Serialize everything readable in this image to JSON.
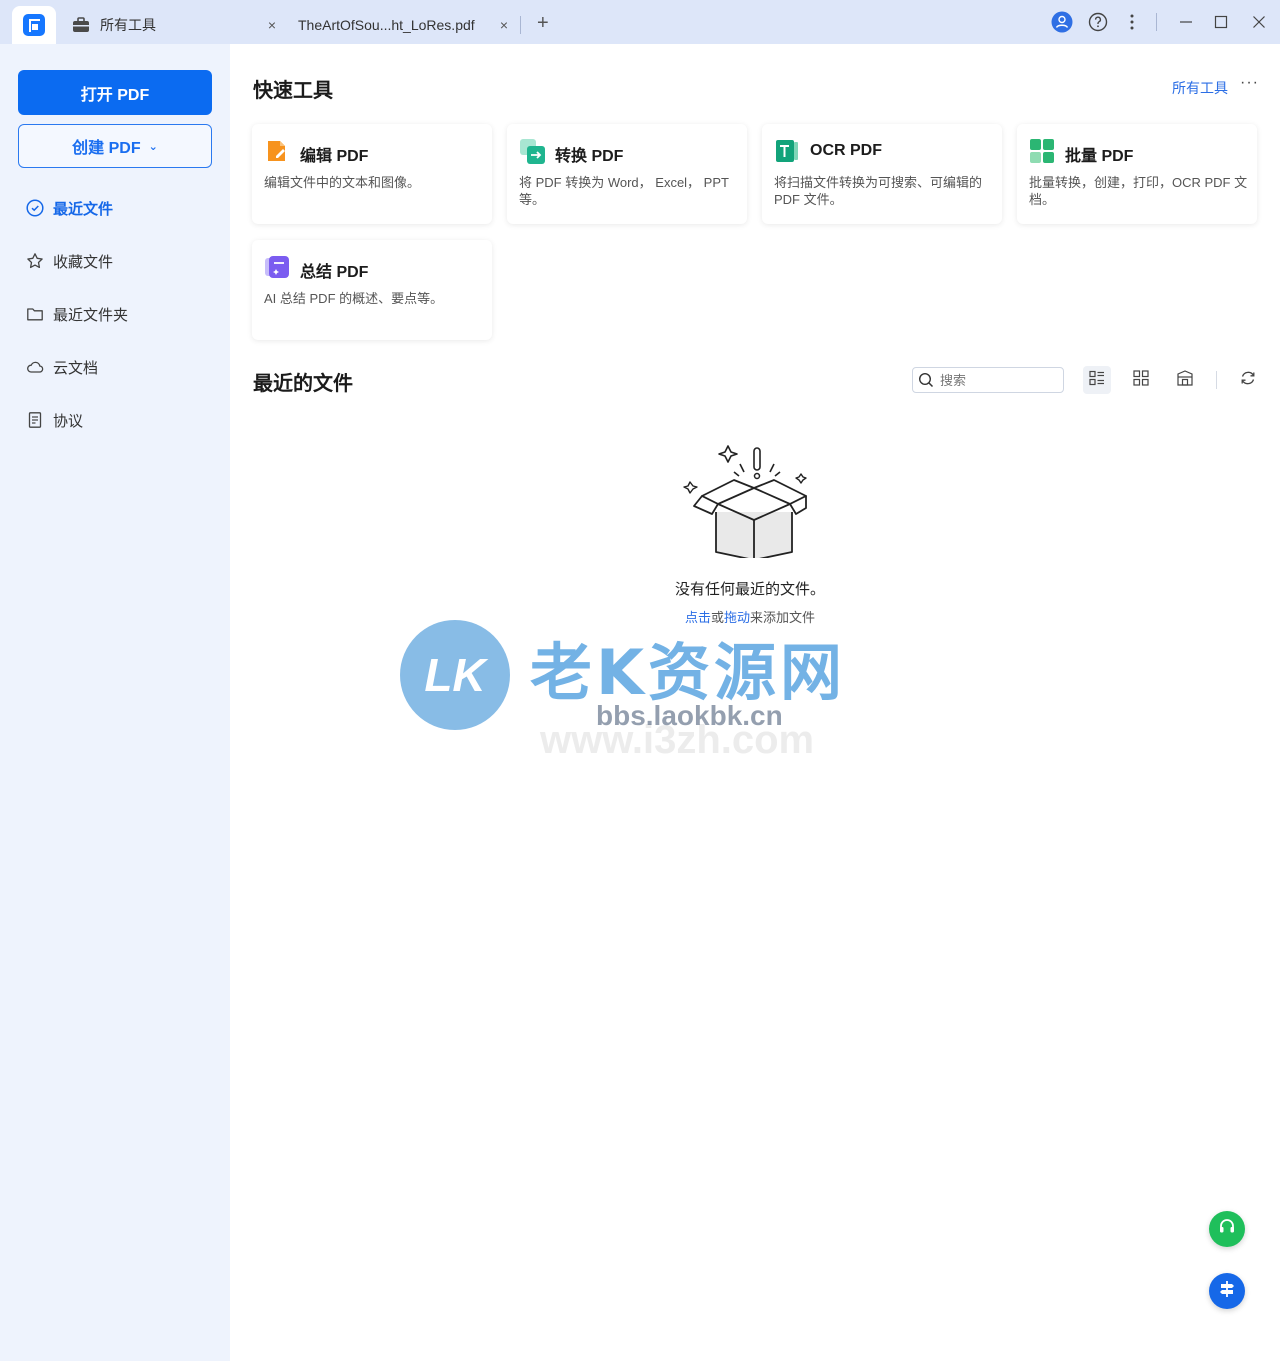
{
  "titlebar": {
    "tabs": [
      {
        "label": "所有工具",
        "icon": "briefcase-icon"
      },
      {
        "label": "TheArtOfSou...ht_LoRes.pdf",
        "icon": ""
      }
    ],
    "close_glyph": "×",
    "add_glyph": "+"
  },
  "sidebar": {
    "open_label": "打开 PDF",
    "create_label": "创建 PDF",
    "items": [
      {
        "label": "最近文件",
        "icon": "clock-icon",
        "active": true
      },
      {
        "label": "收藏文件",
        "icon": "star-icon"
      },
      {
        "label": "最近文件夹",
        "icon": "folder-icon"
      },
      {
        "label": "云文档",
        "icon": "cloud-icon"
      },
      {
        "label": "协议",
        "icon": "document-icon"
      }
    ]
  },
  "quick_tools": {
    "title": "快速工具",
    "all_tools_link": "所有工具",
    "more": "···",
    "cards": [
      {
        "title": "编辑 PDF",
        "desc": "编辑文件中的文本和图像。",
        "icon": "edit-pdf-icon",
        "color": "#f7931e"
      },
      {
        "title": "转换 PDF",
        "desc": "将 PDF 转换为 Word， Excel， PPT 等。",
        "icon": "convert-pdf-icon",
        "color": "#1fb58f"
      },
      {
        "title": "OCR PDF",
        "desc": "将扫描文件转换为可搜索、可编辑的 PDF 文件。",
        "icon": "ocr-pdf-icon",
        "color": "#12a37a"
      },
      {
        "title": "批量 PDF",
        "desc": "批量转换，创建，打印，OCR PDF 文档。",
        "icon": "batch-pdf-icon",
        "color": "#2bb673"
      },
      {
        "title": "总结 PDF",
        "desc": "AI 总结 PDF 的概述、要点等。",
        "icon": "summarize-pdf-icon",
        "color": "#7b5cf0"
      }
    ]
  },
  "recent": {
    "title": "最近的文件",
    "search_placeholder": "搜索",
    "empty_text": "没有任何最近的文件。",
    "hint_click": "点击",
    "hint_or": "或",
    "hint_drag": "拖动",
    "hint_rest": "来添加文件"
  },
  "watermark": {
    "logo_text": "LK",
    "title": "老K资源网",
    "url": "bbs.laokbk.cn",
    "url2": "www.i3zh.com"
  },
  "colors": {
    "primary": "#0b6bf1",
    "sidebar_bg": "#eef3fd",
    "titlebar_bg": "#dde6f9",
    "support_green": "#1fbf5b",
    "feedback_blue": "#1668e8"
  }
}
